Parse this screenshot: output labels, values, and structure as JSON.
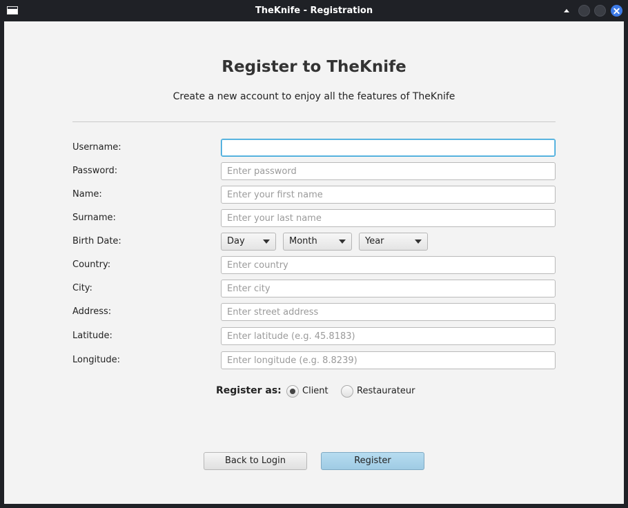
{
  "window": {
    "title": "TheKnife - Registration"
  },
  "header": {
    "title": "Register to TheKnife",
    "subtitle": "Create a new account to enjoy all the features of TheKnife"
  },
  "form": {
    "username": {
      "label": "Username:",
      "value": "",
      "placeholder": ""
    },
    "password": {
      "label": "Password:",
      "value": "",
      "placeholder": "Enter password"
    },
    "name": {
      "label": "Name:",
      "value": "",
      "placeholder": "Enter your first name"
    },
    "surname": {
      "label": "Surname:",
      "value": "",
      "placeholder": "Enter your last name"
    },
    "birth_date": {
      "label": "Birth Date:",
      "day": "Day",
      "month": "Month",
      "year": "Year"
    },
    "country": {
      "label": "Country:",
      "value": "",
      "placeholder": "Enter country"
    },
    "city": {
      "label": "City:",
      "value": "",
      "placeholder": "Enter city"
    },
    "address": {
      "label": "Address:",
      "value": "",
      "placeholder": "Enter street address"
    },
    "latitude": {
      "label": "Latitude:",
      "value": "",
      "placeholder": "Enter latitude (e.g. 45.8183)"
    },
    "longitude": {
      "label": "Longitude:",
      "value": "",
      "placeholder": "Enter longitude (e.g. 8.8239)"
    }
  },
  "register_as": {
    "label": "Register as:",
    "options": [
      {
        "label": "Client",
        "selected": true
      },
      {
        "label": "Restaurateur",
        "selected": false
      }
    ]
  },
  "buttons": {
    "back": "Back to Login",
    "register": "Register"
  },
  "colors": {
    "focus": "#2c9fd6",
    "primary_button": "#a9d3ea",
    "close_button": "#3d7ae6"
  }
}
